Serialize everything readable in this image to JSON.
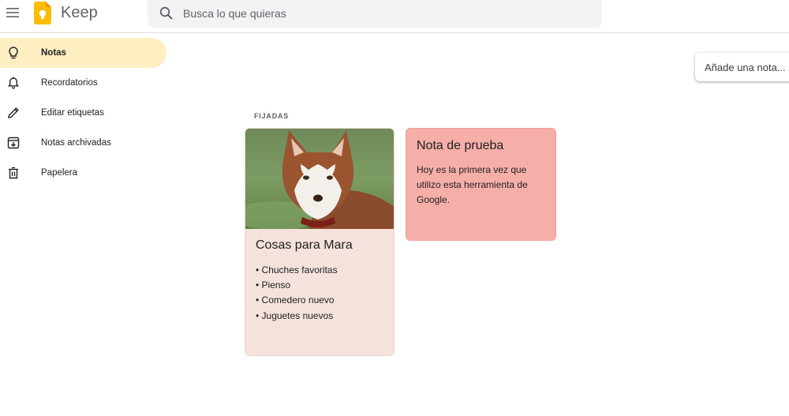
{
  "app": {
    "name": "Keep"
  },
  "search": {
    "placeholder": "Busca lo que quieras"
  },
  "sidebar": {
    "items": [
      {
        "label": "Notas",
        "icon": "lightbulb-icon",
        "active": true
      },
      {
        "label": "Recordatorios",
        "icon": "bell-icon"
      },
      {
        "label": "Editar etiquetas",
        "icon": "pencil-icon"
      },
      {
        "label": "Notas archivadas",
        "icon": "archive-icon"
      },
      {
        "label": "Papelera",
        "icon": "trash-icon"
      }
    ]
  },
  "take_note": {
    "placeholder": "Añade una nota..."
  },
  "pinned": {
    "label": "FIJADAS",
    "notes": [
      {
        "title": "Cosas para Mara",
        "image": "husky-dog-photo",
        "color": "#f6e2dd",
        "items": [
          "• Chuches favoritas",
          "• Pienso",
          "• Comedero nuevo",
          "• Juguetes nuevos"
        ]
      },
      {
        "title": "Nota de prueba",
        "color": "#f6aea9",
        "body": "Hoy es la primera vez que utilizo esta herramienta de Google."
      }
    ]
  },
  "colors": {
    "active_nav": "#feefc3",
    "search_bg": "#f1f3f4",
    "logo": "#fbbc04"
  }
}
